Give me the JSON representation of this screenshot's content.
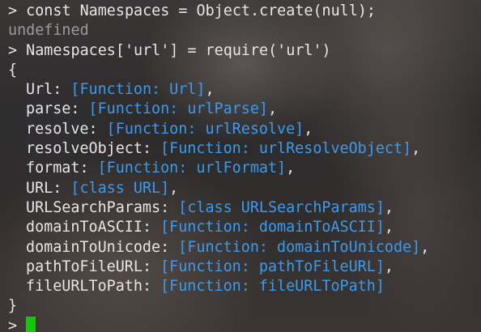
{
  "commands": {
    "prompt": ">",
    "cmd1": "const Namespaces = Object.create(null);",
    "result1": "undefined",
    "cmd2": "Namespaces['url'] = require('url')"
  },
  "output": {
    "open_brace": "{",
    "close_brace": "}",
    "entries": [
      {
        "key": "Url",
        "value": "[Function: Url]",
        "sep": ","
      },
      {
        "key": "parse",
        "value": "[Function: urlParse]",
        "sep": ","
      },
      {
        "key": "resolve",
        "value": "[Function: urlResolve]",
        "sep": ","
      },
      {
        "key": "resolveObject",
        "value": "[Function: urlResolveObject]",
        "sep": ","
      },
      {
        "key": "format",
        "value": "[Function: urlFormat]",
        "sep": ","
      },
      {
        "key": "URL",
        "value": "[class URL]",
        "sep": ","
      },
      {
        "key": "URLSearchParams",
        "value": "[class URLSearchParams]",
        "sep": ","
      },
      {
        "key": "domainToASCII",
        "value": "[Function: domainToASCII]",
        "sep": ","
      },
      {
        "key": "domainToUnicode",
        "value": "[Function: domainToUnicode]",
        "sep": ","
      },
      {
        "key": "pathToFileURL",
        "value": "[Function: pathToFileURL]",
        "sep": ","
      },
      {
        "key": "fileURLToPath",
        "value": "[Function: fileURLToPath]",
        "sep": ""
      }
    ]
  },
  "colors": {
    "text": "#e6e6e6",
    "dim": "#9a9a9a",
    "function_blue": "#3b9bef",
    "cursor_green": "#16c60c"
  }
}
